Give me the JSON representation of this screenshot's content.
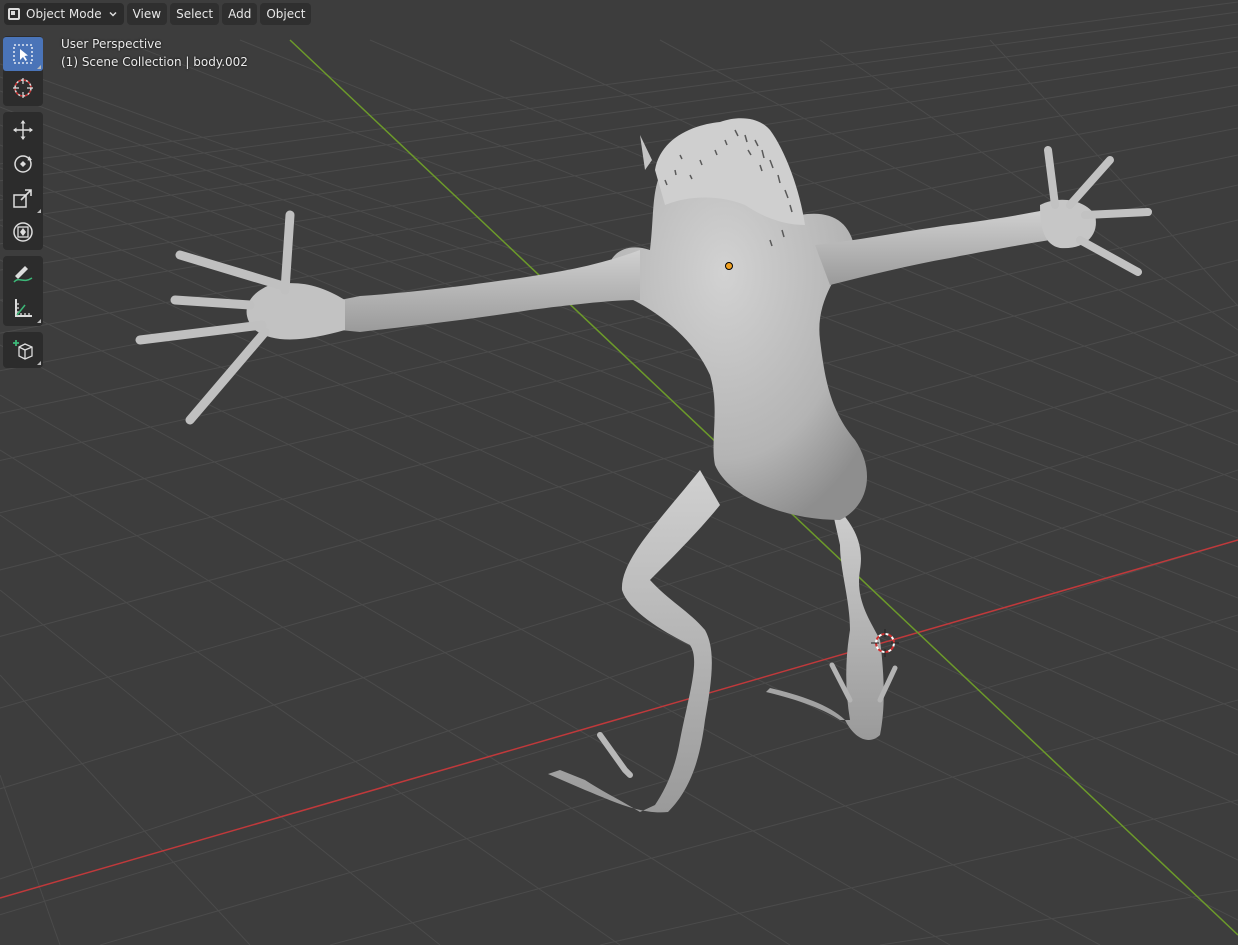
{
  "header": {
    "mode_label": "Object Mode",
    "menus": [
      "View",
      "Select",
      "Add",
      "Object"
    ]
  },
  "overlay": {
    "view_name": "User Perspective",
    "collection_info": "(1) Scene Collection | body.002"
  },
  "toolbar": {
    "tools": [
      "select-box-icon",
      "cursor-icon",
      "move-icon",
      "rotate-icon",
      "scale-icon",
      "transform-icon",
      "annotate-icon",
      "measure-icon",
      "add-cube-icon"
    ],
    "active_tool": "select-box-icon"
  },
  "colors": {
    "viewport_bg": "#3d3d3d",
    "grid_line": "#4a4a4a",
    "x_axis": "#c0393b",
    "y_axis": "#6c9a2a",
    "active_tool": "#4a74b8",
    "origin_dot": "#f0a020",
    "model": "#bdbdbd"
  }
}
